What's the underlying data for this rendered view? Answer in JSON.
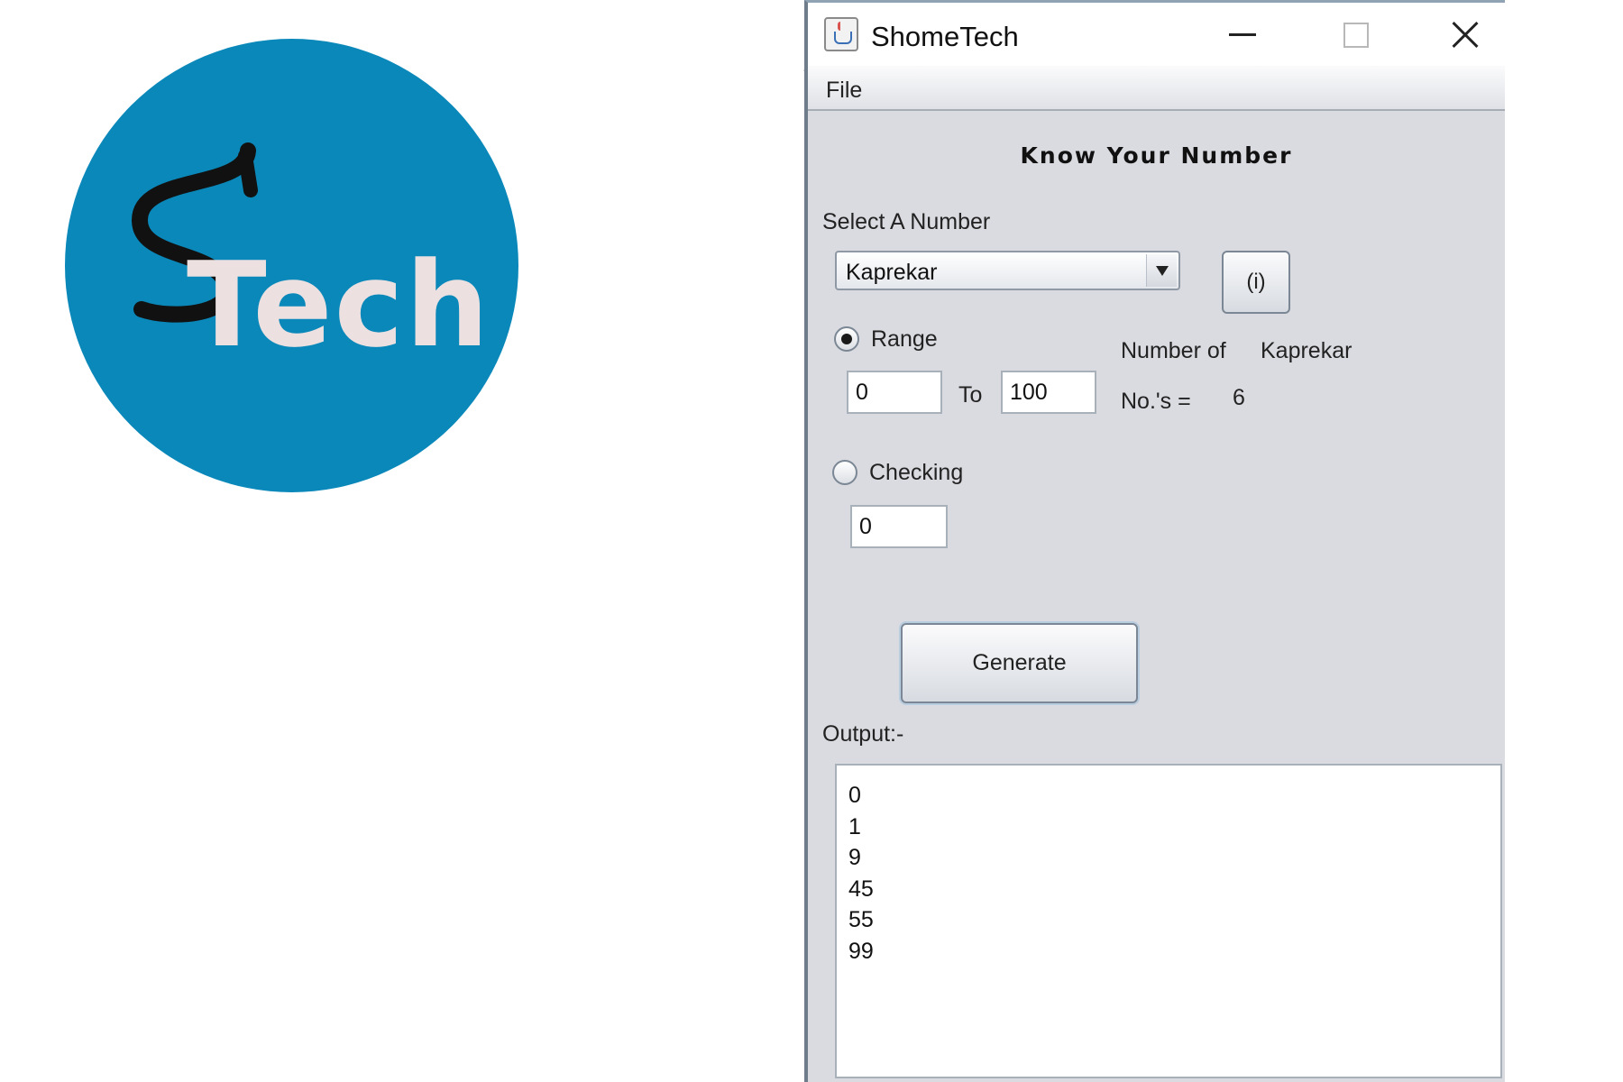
{
  "logo": {
    "letter": "S",
    "word": "Tech"
  },
  "window": {
    "title": "ShomeTech",
    "stray_char": "1",
    "menu": [
      "File"
    ],
    "heading": "Know Your Number",
    "select_label": "Select A Number",
    "selected_number": "Kaprekar",
    "info_button": "(i)",
    "range": {
      "label": "Range",
      "selected": true,
      "from": "0",
      "to_label": "To",
      "to": "100"
    },
    "count": {
      "label": "Number of",
      "kind": "Kaprekar",
      "nos_label": "No.'s =",
      "value": "6"
    },
    "checking": {
      "label": "Checking",
      "selected": false,
      "value": "0"
    },
    "generate_button": "Generate",
    "output_label": "Output:-",
    "output_lines": [
      "0",
      "1",
      "9",
      "45",
      "55",
      "99"
    ]
  },
  "colors": {
    "logo_bg": "#0a88ba",
    "logo_text": "#ece0e0",
    "window_bg": "#dadbe0"
  },
  "icons": [
    "java-app-icon",
    "minimize-icon",
    "maximize-icon",
    "close-icon",
    "dropdown-arrow-icon"
  ]
}
